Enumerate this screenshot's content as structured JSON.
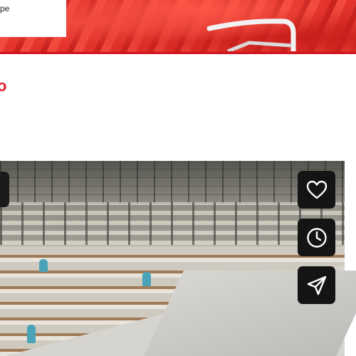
{
  "banner": {
    "caption": "pe"
  },
  "brand": {
    "glyph": "o"
  },
  "media": {
    "actions": [
      {
        "icon": "heart-icon"
      },
      {
        "icon": "clock-icon"
      },
      {
        "icon": "send-icon"
      }
    ]
  },
  "colors": {
    "accent": "#e11d2a",
    "button_bg": "#141414"
  }
}
